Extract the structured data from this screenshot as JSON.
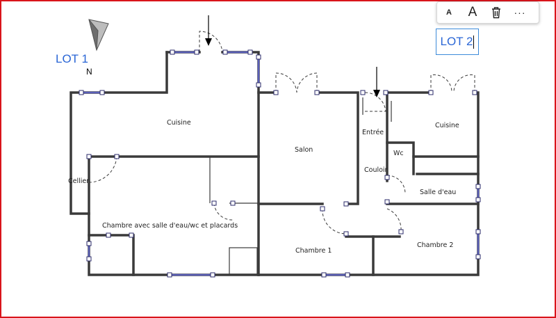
{
  "labels": {
    "lot1": "LOT 1",
    "lot2": "LOT 2",
    "north": "N"
  },
  "rooms": {
    "cuisine_lot1": "Cuisine",
    "cellier": "Cellier",
    "chambre_suite": "Chambre avec salle d'eau/wc et placards",
    "salon": "Salon",
    "entree": "Entrée",
    "couloir": "Couloir",
    "wc": "Wc",
    "cuisine_lot2": "Cuisine",
    "salle_deau": "Salle d'eau",
    "chambre1": "Chambre 1",
    "chambre2": "Chambre 2"
  },
  "toolbar": {
    "font_small": "A",
    "font_large": "A",
    "delete_icon": "trash-icon",
    "more": "···"
  },
  "colors": {
    "frame": "#d9141b",
    "lot_text": "#2a66d6",
    "selection_border": "#3b8ad9",
    "window": "#5a5fb8"
  }
}
